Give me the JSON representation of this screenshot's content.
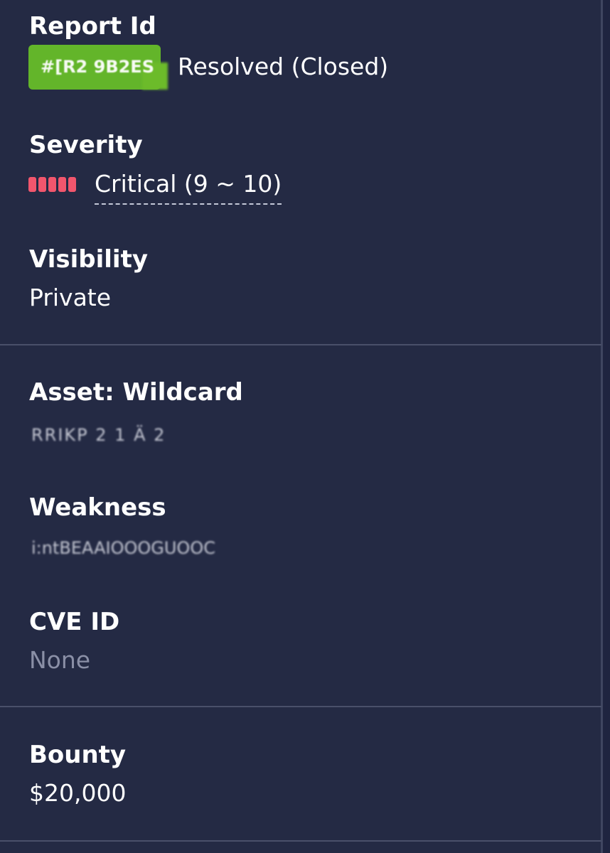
{
  "report": {
    "label": "Report Id",
    "id_text": "#[R2 9B2ES",
    "status": "Resolved (Closed)",
    "status_color": "#63b52a"
  },
  "severity": {
    "label": "Severity",
    "value": "Critical (9 ~ 10)",
    "bar_count": 5,
    "bar_color": "#f2566d"
  },
  "visibility": {
    "label": "Visibility",
    "value": "Private"
  },
  "asset": {
    "label": "Asset: Wildcard",
    "value": "RRIKP 2 1 Ä 2"
  },
  "weakness": {
    "label": "Weakness",
    "value": "i:ntBEAAIOOOGUOOC"
  },
  "cve": {
    "label": "CVE ID",
    "value": "None"
  },
  "bounty": {
    "label": "Bounty",
    "value": "$20,000"
  },
  "colors": {
    "background": "#242a44",
    "divider": "#4a506a",
    "muted_text": "#8a8fa6"
  }
}
